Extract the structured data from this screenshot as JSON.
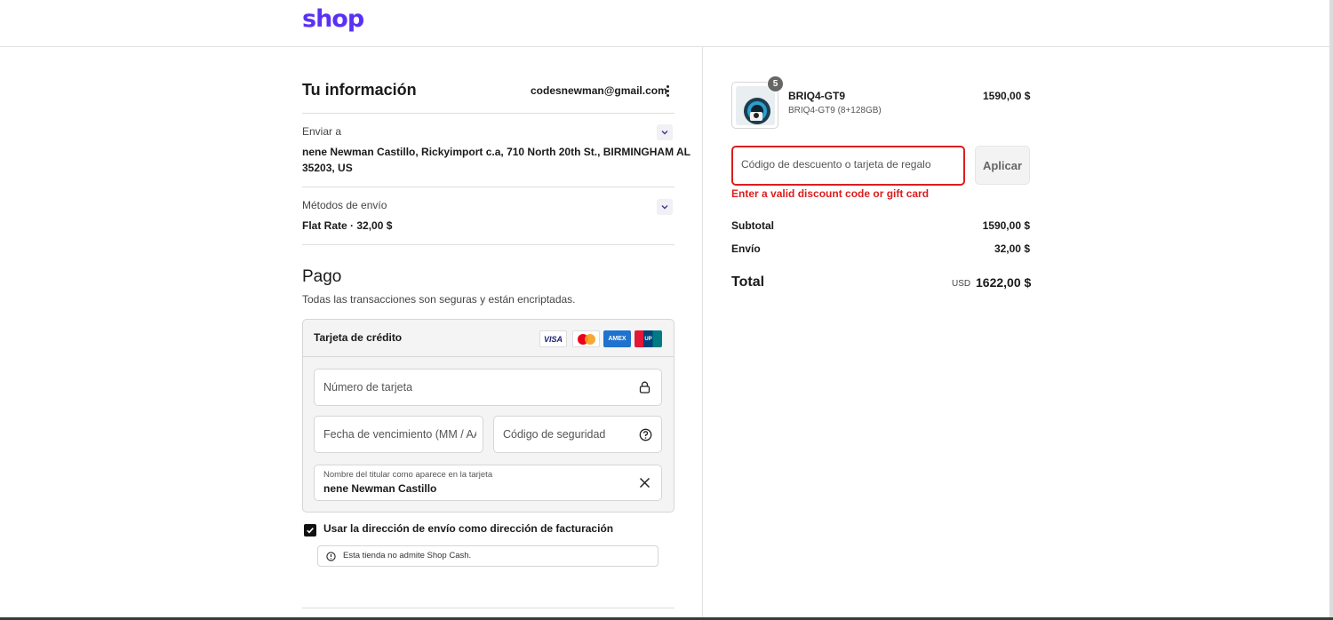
{
  "header": {
    "logo": "shop",
    "brand_color": "#5a31f4"
  },
  "info": {
    "title": "Tu información",
    "email": "codesnewman@gmail.com"
  },
  "shipping_address": {
    "label": "Enviar a",
    "line1": "nene Newman Castillo, Rickyimport c.a, 710 North 20th St., BIRMINGHAM AL",
    "line2": "35203, US"
  },
  "shipping_method": {
    "label": "Métodos de envío",
    "value": "Flat Rate · 32,00 $"
  },
  "payment": {
    "title": "Pago",
    "subtitle": "Todas las transacciones son seguras y están encriptadas.",
    "method_label": "Tarjeta de crédito",
    "brands": [
      "VISA",
      "Mastercard",
      "AMEX",
      "UnionPay"
    ],
    "card_number_placeholder": "Número de tarjeta",
    "expiry_placeholder": "Fecha de vencimiento (MM / AA)",
    "security_placeholder": "Código de seguridad",
    "name_label": "Nombre del titular como aparece en la tarjeta",
    "name_value": "nene Newman Castillo",
    "billing_checkbox_label": "Usar la dirección de envío como dirección de facturación",
    "billing_checked": true,
    "notice": "Esta tienda no admite Shop Cash."
  },
  "order": {
    "product": {
      "name": "BRIQ4-GT9",
      "variant": "BRIQ4-GT9 (8+128GB)",
      "price": "1590,00 $",
      "quantity": "5"
    },
    "discount_placeholder": "Código de descuento o tarjeta de regalo",
    "apply_label": "Aplicar",
    "error": "Enter a valid discount code or gift card",
    "error_color": "#dd1d1d",
    "subtotal_label": "Subtotal",
    "subtotal_value": "1590,00 $",
    "shipping_label": "Envío",
    "shipping_value": "32,00 $",
    "total_label": "Total",
    "total_currency": "USD",
    "total_value": "1622,00 $"
  }
}
